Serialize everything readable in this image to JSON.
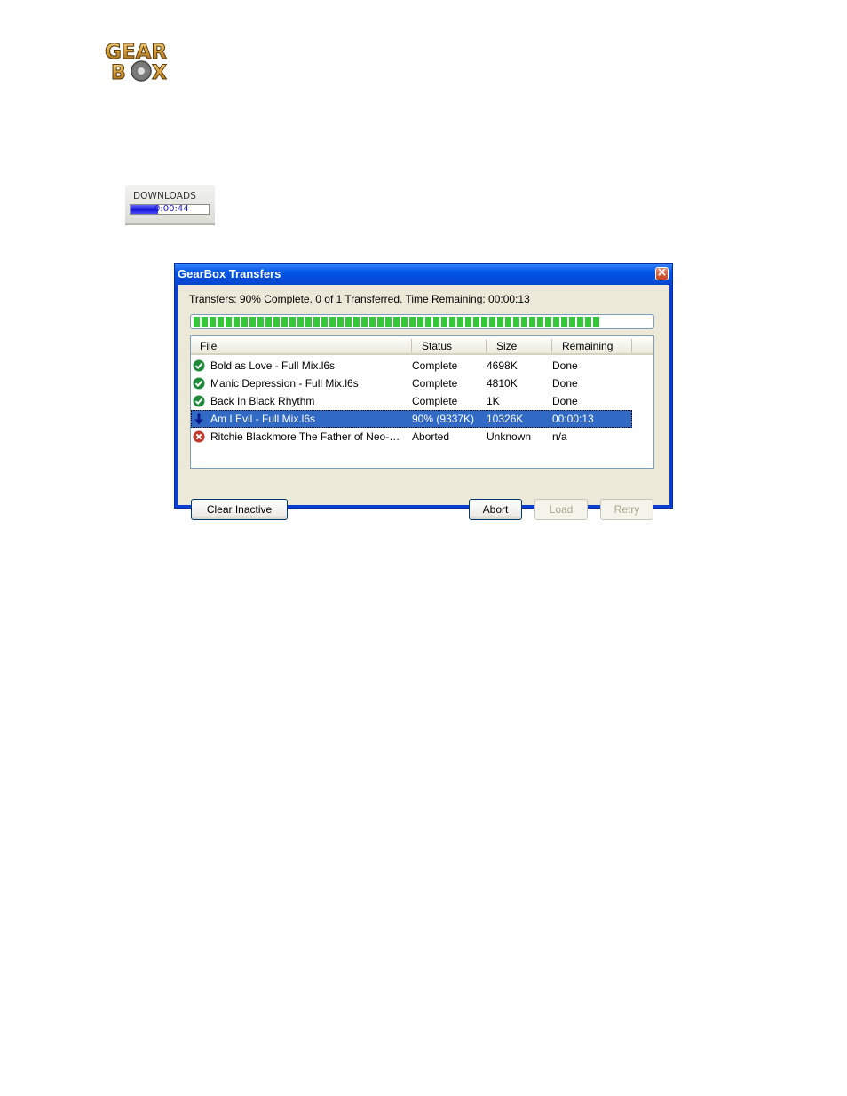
{
  "logo": {
    "text": "GEAR BOX"
  },
  "downloads_widget": {
    "label": "DOWNLOADS",
    "time": "0:00:44",
    "progress_fraction": 0.35
  },
  "dialog": {
    "title": "GearBox Transfers",
    "status_text": "Transfers: 90% Complete. 0 of 1 Transferred. Time Remaining: 00:00:13",
    "progress_fraction": 0.9,
    "columns": [
      "File",
      "Status",
      "Size",
      "Remaining"
    ],
    "rows": [
      {
        "icon": "check-icon",
        "file": "Bold as Love - Full Mix.l6s",
        "status": "Complete",
        "size": "4698K",
        "remaining": "Done",
        "selected": false
      },
      {
        "icon": "check-icon",
        "file": "Manic Depression - Full Mix.l6s",
        "status": "Complete",
        "size": "4810K",
        "remaining": "Done",
        "selected": false
      },
      {
        "icon": "check-icon",
        "file": "Back In Black Rhythm",
        "status": "Complete",
        "size": "1K",
        "remaining": "Done",
        "selected": false
      },
      {
        "icon": "download-arrow-icon",
        "file": "Am I Evil - Full Mix.l6s",
        "status": "90% (9337K)",
        "size": "10326K",
        "remaining": "00:00:13",
        "selected": true
      },
      {
        "icon": "error-x-icon",
        "file": "Ritchie Blackmore The Father of Neo-…",
        "status": "Aborted",
        "size": "Unknown",
        "remaining": "n/a",
        "selected": false
      }
    ],
    "buttons": {
      "clear_inactive": "Clear Inactive",
      "abort": "Abort",
      "load": "Load",
      "retry": "Retry"
    }
  },
  "colors": {
    "title_bar": "#0055e5",
    "selection": "#316ac5",
    "progress_green": "#35c63a",
    "check_green": "#1e8a3a",
    "error_red": "#c0392b"
  }
}
